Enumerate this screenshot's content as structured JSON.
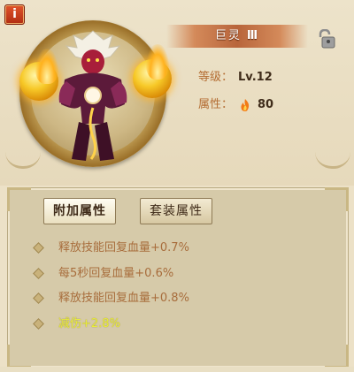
{
  "header": {
    "info_label": "i"
  },
  "hero": {
    "name": "巨灵",
    "rank": "Ⅲ",
    "level_label": "等级：",
    "level_value": "Lv.12",
    "attribute_label": "属性：",
    "attribute_value": "80",
    "attribute_icon": "fire-icon",
    "lock_icon": "unlock-icon"
  },
  "tabs": [
    {
      "label": "附加属性",
      "active": true
    },
    {
      "label": "套装属性",
      "active": false
    }
  ],
  "attributes": [
    {
      "text": "释放技能回复血量+0.7%",
      "color": "#a86d3c"
    },
    {
      "text": "每5秒回复血量+0.6%",
      "color": "#a86d3c"
    },
    {
      "text": "释放技能回复血量+0.8%",
      "color": "#a86d3c"
    },
    {
      "text": "减伤+2.8%",
      "color": "#e9ee3b"
    }
  ]
}
